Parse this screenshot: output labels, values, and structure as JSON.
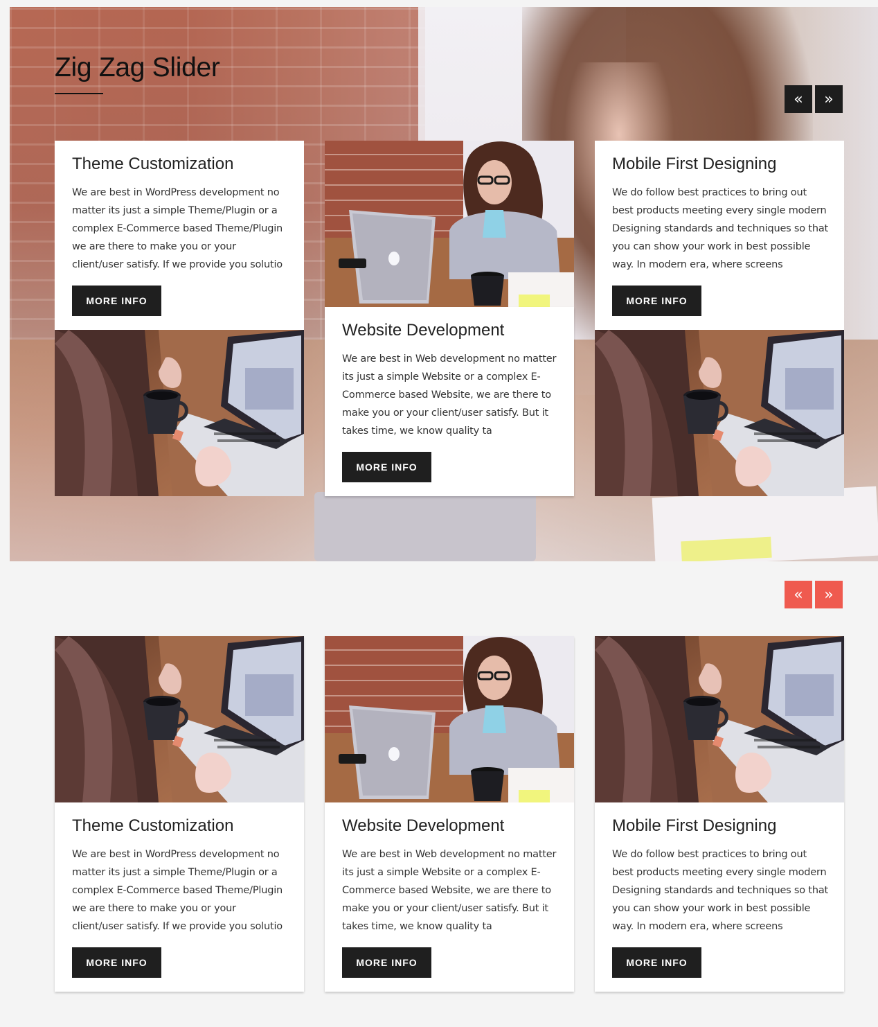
{
  "slider": {
    "title": "Zig Zag Slider",
    "prev_icon": "double-chevron-left-icon",
    "next_icon": "double-chevron-right-icon",
    "prev_glyph": "«",
    "next_glyph": "»"
  },
  "cards": [
    {
      "title": "Theme Customization",
      "description": "We are best in WordPress development no matter its just a simple Theme/Plugin or a complex E-Commerce based Theme/Plugin we are there to make you or your client/user satisfy. If we provide you solutio",
      "button": "MORE INFO",
      "image": "woman-coffee-laptop"
    },
    {
      "title": "Website Development",
      "description": "We are best in Web development no matter its just a simple Website or a complex E-Commerce based Website, we are there to make you or your client/user satisfy. But it takes time, we know quality ta",
      "button": "MORE INFO",
      "image": "woman-glasses-laptop"
    },
    {
      "title": "Mobile First Designing",
      "description": "We do follow best practices to bring out best products meeting every single modern Designing standards and techniques so that you can show your work in best possible way. In modern era, where screens",
      "button": "MORE INFO",
      "image": "woman-coffee-laptop"
    }
  ],
  "colors": {
    "dark_button": "#1f1f1f",
    "accent_red": "#ef5a4f",
    "page_bg": "#f4f4f4"
  }
}
